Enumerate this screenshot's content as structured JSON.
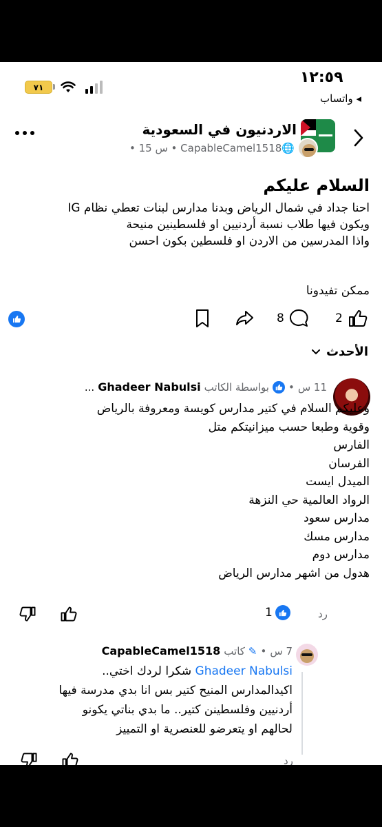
{
  "status_bar": {
    "time": "١٢:٥٩",
    "battery": "٧١",
    "back_app": "◂ واتساب"
  },
  "header": {
    "group_name": "الاردنيون في السعودية",
    "meta": "CapableCamel1518 • س 15 • "
  },
  "post": {
    "title": "السلام عليكم",
    "lines": [
      "احنا جداد في شمال الرياض وبدنا مدارس لبنات تعطي نظام IG",
      "ويكون فيها طلاب نسبة أردنيين او فلسطينين منيحة",
      "واذا المدرسين من الاردن او فلسطين بكون احسن",
      "ممكن تفيدونا"
    ],
    "like_count": "2",
    "comment_count": "8"
  },
  "sort": {
    "label": "الأحدث"
  },
  "comment1": {
    "name": "Ghadeer Nabulsi",
    "author_tag": "بواسطة الكاتب",
    "time": "11 س",
    "lines": [
      "وعليكم السلام في كتير مدارس كويسة ومعروفة بالرياض",
      "وقوية وطبعا حسب ميزانيتكم متل",
      "الفارس",
      "الفرسان",
      "الميدل ايست",
      "الرواد العالمية حي النزهة",
      "مدارس سعود",
      "مدارس مسك",
      "مدارس دوم",
      "هدول من اشهر مدارس الرياض"
    ],
    "reply": "رد",
    "like_count": "1"
  },
  "comment2": {
    "name": "CapableCamel1518",
    "tag": "كاتب",
    "time": "7 س",
    "mention": "Ghadeer Nabulsi",
    "first_line": " شكرا لردك اختي..",
    "lines": [
      "اكيدالمدارس المنيح كتير بس انا بدي مدرسة فيها",
      "أردنيين وفلسطينن كتير.. ما بدي بناتي يكونو",
      "لحالهم او يتعرضو للعنصرية او التمييز"
    ],
    "reply": "رد"
  },
  "colors": {
    "accent": "#1877f2",
    "meta": "#65676b"
  }
}
